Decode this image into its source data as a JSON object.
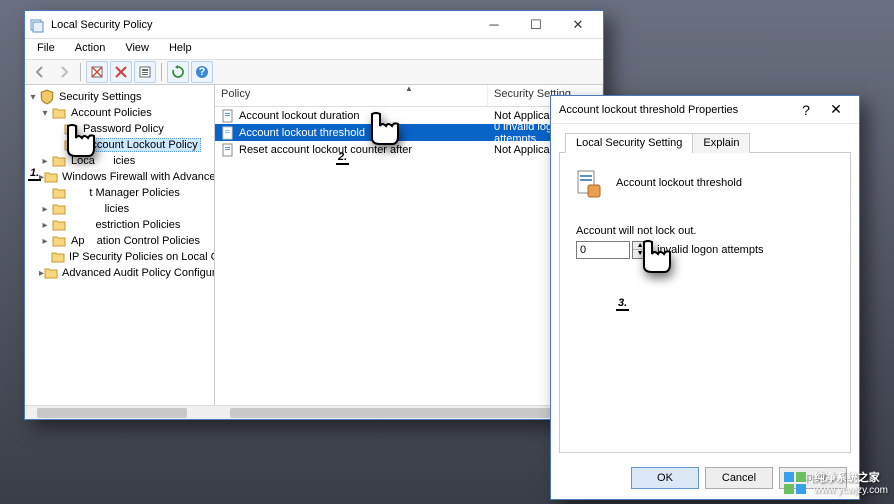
{
  "main_window": {
    "title": "Local Security Policy",
    "menus": [
      "File",
      "Action",
      "View",
      "Help"
    ],
    "tree": {
      "root": "Security Settings",
      "items": [
        {
          "label": "Account Policies",
          "depth": 1,
          "expanded": true
        },
        {
          "label": "Password Policy",
          "depth": 2,
          "leaf": true
        },
        {
          "label": "Account Lockout Policy",
          "depth": 2,
          "leaf": true,
          "selected": true
        },
        {
          "label": "Local Policies",
          "depth": 1,
          "expanded": false,
          "partial_hidden": "Loca"
        },
        {
          "label": "Windows Firewall with Advanced Secu",
          "depth": 1
        },
        {
          "label": "Network List Manager Policies",
          "depth": 1,
          "partial_hidden": "t Manager Policies"
        },
        {
          "label": "Public Key Policies",
          "depth": 1,
          "partial_hidden": "licies"
        },
        {
          "label": "Software Restriction Policies",
          "depth": 1,
          "partial_hidden": "estriction Policies"
        },
        {
          "label": "Application Control Policies",
          "depth": 1,
          "partial_hidden": "ation Control Policies"
        },
        {
          "label": "IP Security Policies on Local Computer",
          "depth": 1
        },
        {
          "label": "Advanced Audit Policy Configuration",
          "depth": 1
        }
      ]
    },
    "columns": {
      "policy": "Policy",
      "setting": "Security Setting"
    },
    "rows": [
      {
        "policy": "Account lockout duration",
        "setting": "Not Applicable"
      },
      {
        "policy": "Account lockout threshold",
        "setting": "0 invalid logon attempts",
        "selected": true
      },
      {
        "policy": "Reset account lockout counter after",
        "setting": "Not Applicable"
      }
    ]
  },
  "dialog": {
    "title": "Account lockout threshold Properties",
    "tabs": {
      "local": "Local Security Setting",
      "explain": "Explain"
    },
    "policy_name": "Account lockout threshold",
    "note": "Account will not lock out.",
    "value": "0",
    "value_suffix": "invalid logon attempts",
    "buttons": {
      "ok": "OK",
      "cancel": "Cancel",
      "apply": "Apply"
    }
  },
  "annotations": {
    "one": "1.",
    "two": "2.",
    "three": "3."
  },
  "watermark": {
    "text": "纯净系统之家",
    "url": "www.ycwjzy.com"
  }
}
